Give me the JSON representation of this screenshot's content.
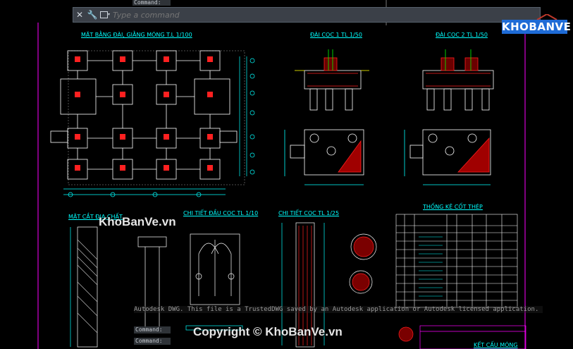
{
  "app": {
    "command_history_top": "Command:",
    "command_history_1": "Command:",
    "command_history_2": "Command:"
  },
  "command_line": {
    "placeholder": "Type a command",
    "close_glyph": "✕",
    "settings_glyph": "🔧"
  },
  "logo": {
    "text": "KHOBANVE"
  },
  "sheet_titles": {
    "plan": "MẶT BẰNG ĐÀI, GIẰNG MÓNG T.L 1/100",
    "pile_cap_1": "ĐÀI CỌC 1 TL 1/50",
    "pile_cap_2": "ĐÀI CỌC 2 TL 1/50",
    "geology": "MẶT CẮT ĐỊA CHẤT",
    "pile_head": "CHI TIẾT ĐẦU CỌC TL 1/10",
    "pile_detail": "CHI TIẾT CỌC TL 1/25",
    "rebar_stats": "THỐNG KÊ CỐT THÉP",
    "footer": "KẾT CẤU MÓNG"
  },
  "watermarks": {
    "top": "KhoBanVe.vn",
    "bottom": "Copyright © KhoBanVe.vn"
  },
  "notice": {
    "text": "Autodesk DWG.  This file is a TrustedDWG saved by an Autodesk application or Autodesk licensed application."
  },
  "colors": {
    "line": "#00ffff",
    "white": "#ffffff",
    "red": "#ff2020",
    "magenta": "#ff00ff",
    "yellow": "#ffff00",
    "green": "#00ff00"
  }
}
